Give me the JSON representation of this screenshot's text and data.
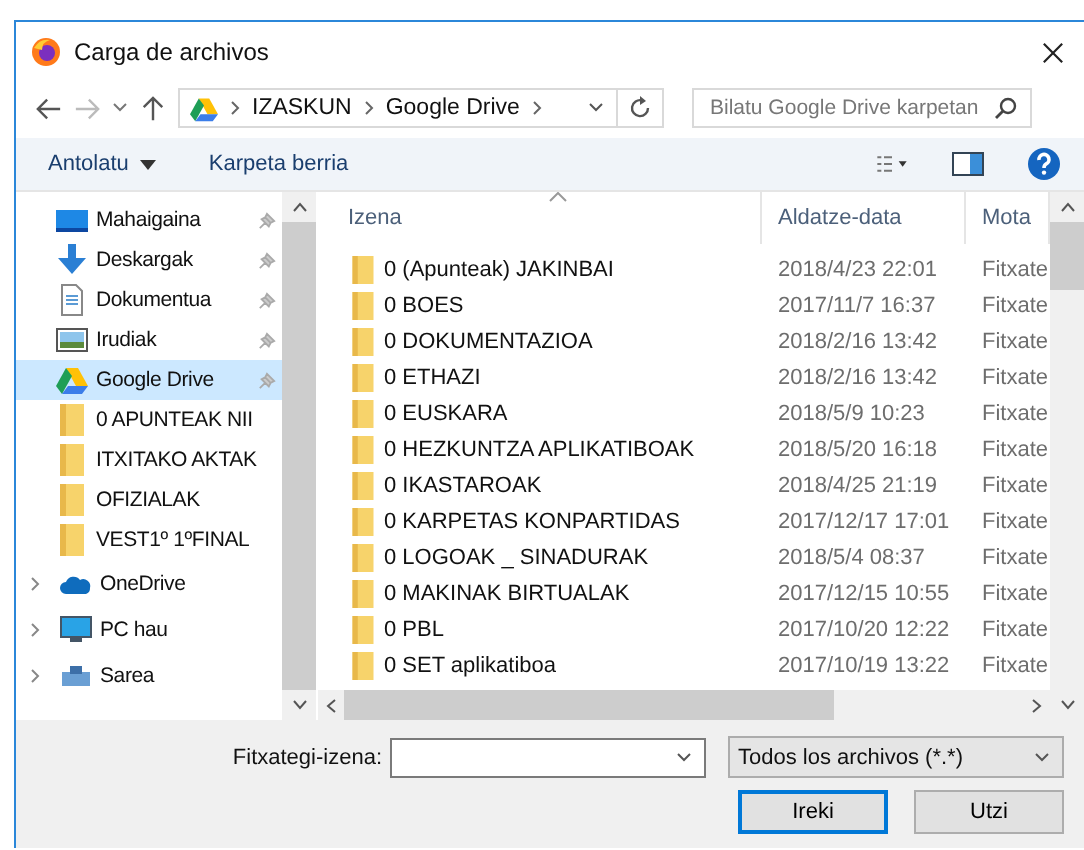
{
  "window": {
    "title": "Carga de archivos"
  },
  "address_bar": {
    "path": [
      "IZASKUN",
      "Google Drive"
    ]
  },
  "search": {
    "placeholder": "Bilatu Google Drive karpetan"
  },
  "toolbar": {
    "organize": "Antolatu",
    "new_folder": "Karpeta berria"
  },
  "sidebar": {
    "items": [
      {
        "label": "Mahaigaina",
        "kind": "desktop",
        "pinned": true,
        "selected": false
      },
      {
        "label": "Deskargak",
        "kind": "download",
        "pinned": true,
        "selected": false
      },
      {
        "label": "Dokumentua",
        "kind": "document",
        "pinned": true,
        "selected": false
      },
      {
        "label": "Irudiak",
        "kind": "picture",
        "pinned": true,
        "selected": false
      },
      {
        "label": "Google Drive",
        "kind": "drive",
        "pinned": true,
        "selected": true
      },
      {
        "label": "0 APUNTEAK NII",
        "kind": "folder",
        "pinned": false,
        "selected": false
      },
      {
        "label": "ITXITAKO AKTAK",
        "kind": "folder",
        "pinned": false,
        "selected": false
      },
      {
        "label": "OFIZIALAK",
        "kind": "folder",
        "pinned": false,
        "selected": false
      },
      {
        "label": "VEST1º 1ºFINAL",
        "kind": "folder",
        "pinned": false,
        "selected": false
      },
      {
        "label": "OneDrive",
        "kind": "cloud",
        "pinned": false,
        "selected": false,
        "expanded": false
      },
      {
        "label": "PC hau",
        "kind": "computer",
        "pinned": false,
        "selected": false,
        "expanded": false
      },
      {
        "label": "Sarea",
        "kind": "network",
        "pinned": false,
        "selected": false,
        "expanded": false
      }
    ]
  },
  "table": {
    "columns": [
      "Izena",
      "Aldatze-data",
      "Mota"
    ],
    "rows": [
      {
        "name": "0 (Apunteak) JAKINBAI",
        "date": "2018/4/23 22:01",
        "type": "Fitxate"
      },
      {
        "name": "0 BOES",
        "date": "2017/11/7 16:37",
        "type": "Fitxate"
      },
      {
        "name": "0 DOKUMENTAZIOA",
        "date": "2018/2/16 13:42",
        "type": "Fitxate"
      },
      {
        "name": "0 ETHAZI",
        "date": "2018/2/16 13:42",
        "type": "Fitxate"
      },
      {
        "name": "0 EUSKARA",
        "date": "2018/5/9 10:23",
        "type": "Fitxate"
      },
      {
        "name": "0 HEZKUNTZA APLIKATIBOAK",
        "date": "2018/5/20 16:18",
        "type": "Fitxate"
      },
      {
        "name": "0 IKASTAROAK",
        "date": "2018/4/25 21:19",
        "type": "Fitxate"
      },
      {
        "name": "0 KARPETAS KONPARTIDAS",
        "date": "2017/12/17 17:01",
        "type": "Fitxate"
      },
      {
        "name": "0 LOGOAK _ SINADURAK",
        "date": "2018/5/4 08:37",
        "type": "Fitxate"
      },
      {
        "name": "0 MAKINAK BIRTUALAK",
        "date": "2017/12/15 10:55",
        "type": "Fitxate"
      },
      {
        "name": "0 PBL",
        "date": "2017/10/20 12:22",
        "type": "Fitxate"
      },
      {
        "name": "0 SET aplikatiboa",
        "date": "2017/10/19 13:22",
        "type": "Fitxate"
      }
    ]
  },
  "footer": {
    "filename_label": "Fitxategi-izena:",
    "filter": "Todos los archivos (*.*)",
    "buttons": [
      "Ireki",
      "Utzi"
    ]
  }
}
